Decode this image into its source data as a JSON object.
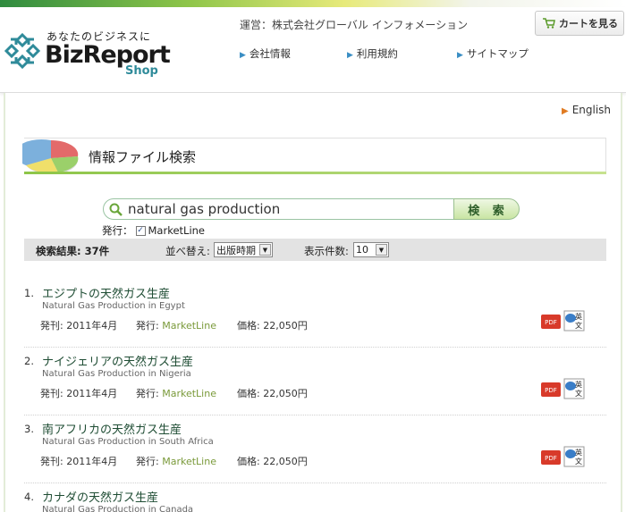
{
  "header": {
    "logo_tagline": "あなたのビジネスに",
    "logo_main": "BizReport",
    "logo_sub": "Shop",
    "operator": "運営：株式会社グローバル インフォメーション",
    "nav": [
      "会社情報",
      "利用規約",
      "サイトマップ"
    ],
    "cart_label": "カートを見る"
  },
  "language_link": "English",
  "search": {
    "title": "情報ファイル検索",
    "query": "natural gas production",
    "button_label": "検 索",
    "publisher_label": "発行：",
    "publisher_value": "MarketLine",
    "result_count": "検索結果: 37件",
    "sort_label": "並べ替え:",
    "sort_value": "出版時期",
    "per_page_label": "表示件数:",
    "per_page_value": "10"
  },
  "results": [
    {
      "num": "1.",
      "title": "エジプトの天然ガス生産",
      "en": "Natural Gas Production in Egypt",
      "date": "発刊: 2011年4月",
      "pub_label": "発行:",
      "pub": "MarketLine",
      "price": "価格: 22,050円"
    },
    {
      "num": "2.",
      "title": "ナイジェリアの天然ガス生産",
      "en": "Natural Gas Production in Nigeria",
      "date": "発刊: 2011年4月",
      "pub_label": "発行:",
      "pub": "MarketLine",
      "price": "価格: 22,050円"
    },
    {
      "num": "3.",
      "title": "南アフリカの天然ガス生産",
      "en": "Natural Gas Production in South Africa",
      "date": "発刊: 2011年4月",
      "pub_label": "発行:",
      "pub": "MarketLine",
      "price": "価格: 22,050円"
    },
    {
      "num": "4.",
      "title": "カナダの天然ガス生産",
      "en": "Natural Gas Production in Canada",
      "date": "",
      "pub_label": "",
      "pub": "",
      "price": ""
    }
  ],
  "icons": {
    "pdf_label": "PDF",
    "en_label_top": "英",
    "en_label_bottom": "文"
  },
  "colors": {
    "accent_green": "#8dc548",
    "title_green": "#1f4d34",
    "publisher": "#7a9a3a"
  }
}
